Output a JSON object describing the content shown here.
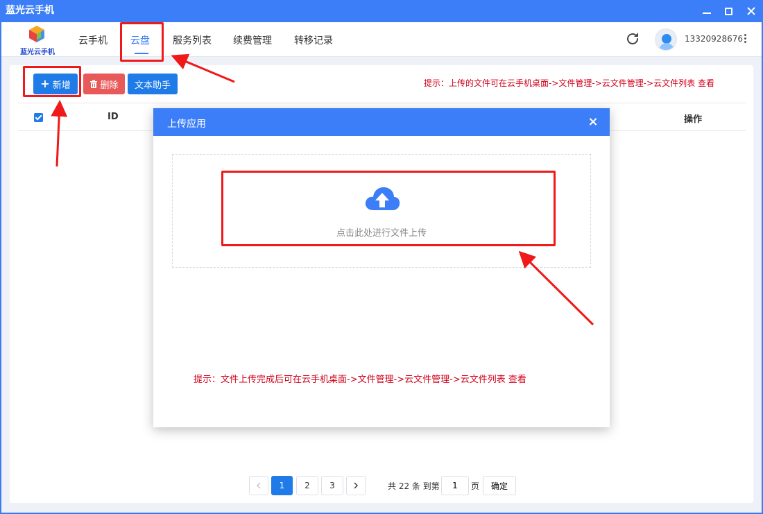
{
  "window": {
    "title": "蓝光云手机"
  },
  "header": {
    "logo_text": "蓝光云手机",
    "nav": [
      "云手机",
      "云盘",
      "服务列表",
      "续费管理",
      "转移记录"
    ],
    "active_nav": "云盘",
    "username": "13320928676"
  },
  "toolbar": {
    "add_label": "新增",
    "delete_label": "删除",
    "text_helper_label": "文本助手",
    "tip": "提示：上传的文件可在云手机桌面->文件管理->云文件管理->云文件列表 查看"
  },
  "table": {
    "columns": [
      "ID",
      "操作"
    ]
  },
  "pagination": {
    "pages": [
      "1",
      "2",
      "3"
    ],
    "current_page": "1",
    "total_text": "共 22 条 到第",
    "jump_value": "1",
    "page_suffix": "页",
    "confirm_label": "确定"
  },
  "modal": {
    "title": "上传应用",
    "close": "×",
    "dropzone_text": "点击此处进行文件上传",
    "tip": "提示：文件上传完成后可在云手机桌面->文件管理->云文件管理->云文件列表 查看"
  },
  "colors": {
    "primary": "#3b7ef7",
    "danger": "#e85a5a",
    "tip_red": "#d0021b",
    "annotation_red": "#f01818"
  }
}
